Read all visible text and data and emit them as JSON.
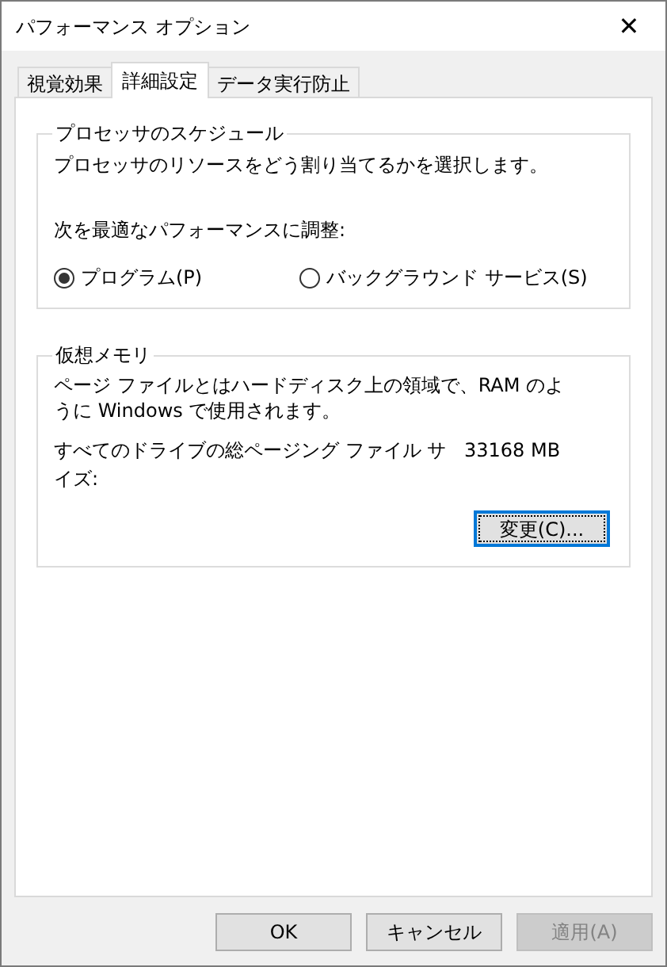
{
  "window": {
    "title": "パフォーマンス オプション",
    "close": "✕"
  },
  "tabs": [
    {
      "label": "視覚効果",
      "selected": false
    },
    {
      "label": "詳細設定",
      "selected": true
    },
    {
      "label": "データ実行防止",
      "selected": false
    }
  ],
  "processor_group": {
    "title": "プロセッサのスケジュール",
    "description": "プロセッサのリソースをどう割り当てるかを選択します。",
    "adjust_label": "次を最適なパフォーマンスに調整:",
    "options": [
      {
        "label": "プログラム(P)",
        "selected": true
      },
      {
        "label": "バックグラウンド サービス(S)",
        "selected": false
      }
    ]
  },
  "memory_group": {
    "title": "仮想メモリ",
    "description": "ページ ファイルとはハードディスク上の領域で、RAM のように Windows で使用されます。",
    "size_label": "すべてのドライブの総ページング ファイル サイズ:",
    "size_value": "33168 MB",
    "change_button": {
      "label": "変更(C)...",
      "focused": true
    }
  },
  "buttons": [
    {
      "label": "OK",
      "disabled": false
    },
    {
      "label": "キャンセル",
      "disabled": false
    },
    {
      "label": "適用(A)",
      "disabled": true
    }
  ]
}
